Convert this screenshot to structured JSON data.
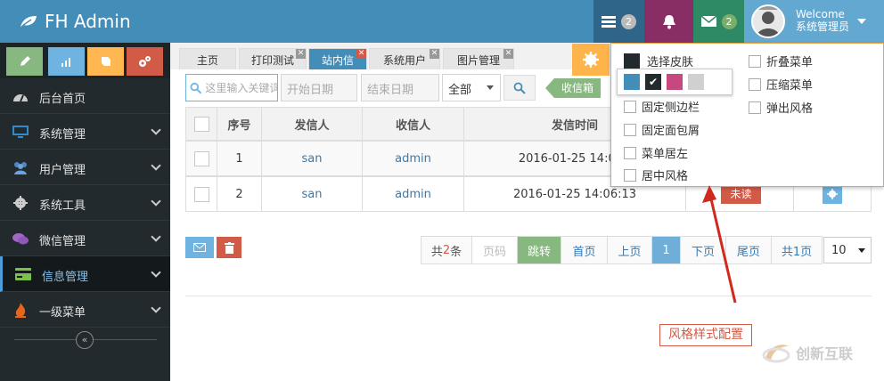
{
  "app": {
    "title": "FH Admin"
  },
  "navbar": {
    "tasks_count": "2",
    "mail_count": "2",
    "welcome": "Welcome",
    "user_role": "系统管理员"
  },
  "sidebar": {
    "items": [
      {
        "label": "后台首页",
        "icon": "dashboard-icon"
      },
      {
        "label": "系统管理",
        "icon": "desktop-icon"
      },
      {
        "label": "用户管理",
        "icon": "users-icon"
      },
      {
        "label": "系统工具",
        "icon": "gear-icon"
      },
      {
        "label": "微信管理",
        "icon": "chat-icon"
      },
      {
        "label": "信息管理",
        "icon": "credit-card-icon"
      },
      {
        "label": "一级菜单",
        "icon": "fire-icon"
      }
    ],
    "collapse_glyph": "«"
  },
  "tabs": [
    {
      "label": "主页"
    },
    {
      "label": "打印测试"
    },
    {
      "label": "站内信"
    },
    {
      "label": "系统用户"
    },
    {
      "label": "图片管理"
    }
  ],
  "toolbar": {
    "search_placeholder": "这里输入关键词",
    "date_start_placeholder": "开始日期",
    "date_end_placeholder": "结束日期",
    "select_value": "全部",
    "inbox_label": "收信箱"
  },
  "table": {
    "headers": [
      "序号",
      "发信人",
      "收信人",
      "发信时间"
    ],
    "rows": [
      {
        "num": "1",
        "sender": "san",
        "receiver": "admin",
        "time": "2016-01-25 14:05"
      },
      {
        "num": "2",
        "sender": "san",
        "receiver": "admin",
        "time": "2016-01-25 14:06:13",
        "status": "未读"
      }
    ]
  },
  "pagination": {
    "total_prefix": "共",
    "total_count": "2",
    "total_suffix": "条",
    "page_input_placeholder": "页码",
    "go": "跳转",
    "first": "首页",
    "prev": "上页",
    "current": "1",
    "next": "下页",
    "last": "尾页",
    "pages_total": "共1页",
    "page_size": "10"
  },
  "settings": {
    "skin_label": "选择皮肤",
    "fixed_sidebar": "固定侧边栏",
    "fixed_breadcrumb": "固定面包屑",
    "menu_left": "菜单居左",
    "center_style": "居中风格",
    "fold_menu": "折叠菜单",
    "compress_menu": "压缩菜单",
    "popup_style": "弹出风格",
    "swatch_colors": [
      "#438eb9",
      "#222a2d",
      "#c6487e",
      "#d0d0d0"
    ],
    "selected_swatch_glyph": "✔"
  },
  "annotation": {
    "label": "风格样式配置"
  },
  "watermark": {
    "text": "创新互联"
  },
  "colors": {
    "navbar": "#438eb9",
    "sidebar": "#222a2d",
    "accent_green": "#87b87f",
    "accent_red": "#d15b47",
    "accent_orange": "#ffb44b"
  }
}
